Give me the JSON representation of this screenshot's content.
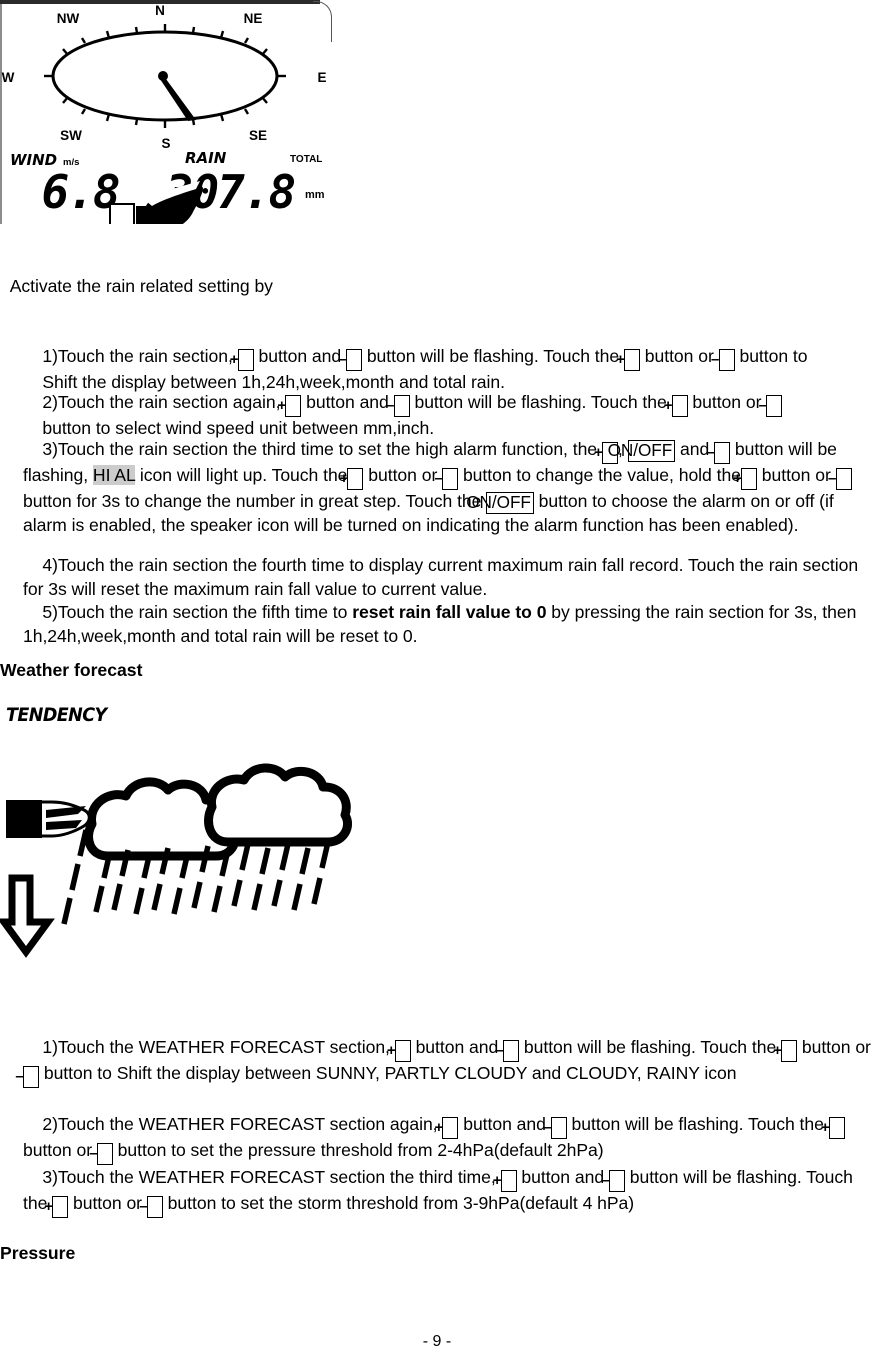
{
  "lcd_display": {
    "title": "wind-rain-lcd-panel",
    "compass": {
      "labels": [
        "N",
        "NE",
        "E",
        "SE",
        "S",
        "SW",
        "W",
        "NW"
      ],
      "needle_direction": "S"
    },
    "wind": {
      "label": "WIND",
      "unit": "m/s",
      "value": "6.8"
    },
    "rain": {
      "label": "RAIN",
      "period_label": "TOTAL",
      "value": "307.8",
      "unit": "mm"
    }
  },
  "rain_section": {
    "intro": "Activate the rain related setting by",
    "items": [
      {
        "number": "1)",
        "line1_a": "Touch the rain section, ",
        "key1": "+",
        "line1_b": " button and ",
        "key2": "–",
        "line1_c": " button will be flashing. Touch the ",
        "key3": "+",
        "line1_d": " button or ",
        "key4": "–",
        "line1_e": " button to",
        "line2": "Shift the display between 1h,24h,week,month and total rain."
      },
      {
        "number": "2)",
        "line1_a": "Touch the rain section again, ",
        "key1": "+",
        "line1_b": " button and ",
        "key2": "–",
        "line1_c": " button will be flashing. Touch the ",
        "key3": "+",
        "line1_d": " button or ",
        "key4": "–",
        "line2": "button to select wind speed unit between mm,inch."
      },
      {
        "number": "3)",
        "a": "Touch the rain section the third time to set the high alarm function, the ",
        "key_plus1": "+",
        "b": ", ",
        "key_onoff1": "ON/OFF",
        "c": " and ",
        "key_minus1": "–",
        "d": " button will be flashing, ",
        "hi_al": "HI AL",
        "e": " icon will light up. Touch the",
        "key_plus2": "+",
        "f": " button or ",
        "key_minus2": "–",
        "g": " button to change the value, hold the",
        "key_plus3": "+",
        "h": " button or ",
        "key_minus3": "–",
        "i": " button for 3s to change the number in great step. Touch the ",
        "key_onoff2": "ON/OFF",
        "j": " button to choose the alarm on or off (if alarm is enabled, the speaker icon will be turned on indicating the alarm function has been enabled)."
      },
      {
        "number": "4)",
        "text": "Touch the rain section the fourth time to display current maximum rain fall record. Touch the rain section for 3s will reset the maximum rain fall value to current value."
      },
      {
        "number": "5)",
        "a": "Touch the rain section the fifth time to ",
        "bold": "reset rain fall value to 0",
        "b": " by pressing the rain section for 3s, then 1h,24h,week,month and total rain will be reset to 0."
      }
    ]
  },
  "weather_forecast": {
    "heading": "Weather forecast",
    "tendency_label": "TENDENCY",
    "icon_name": "rainy-cloud-tendency-falling",
    "items": [
      {
        "number": "1)",
        "a": "Touch the WEATHER FORECAST section, ",
        "key1": "+",
        "b": " button and ",
        "key2": "–",
        "c": " button will be flashing. Touch the ",
        "key3": "+",
        "d": " button or ",
        "key4": "–",
        "e": " button to Shift the display between SUNNY, PARTLY CLOUDY and CLOUDY, RAINY icon"
      },
      {
        "number": "2)",
        "a": "Touch the WEATHER FORECAST section again, ",
        "key1": "+",
        "b": " button and ",
        "key2": "–",
        "c": " button will be flashing. Touch the ",
        "key3": "+",
        "d": " button or ",
        "key4": "–",
        "e": " button to set the pressure threshold from 2-4hPa(default 2hPa)"
      },
      {
        "number": "3)",
        "a": "Touch the WEATHER FORECAST section the third time, ",
        "key1": "+",
        "b": " button and ",
        "key2": "–",
        "c": " button will be flashing. Touch the ",
        "key3": "+",
        "d": " button or ",
        "key4": "–",
        "e": " button to set the storm threshold from 3-9hPa(default 4 hPa)"
      }
    ]
  },
  "pressure_section": {
    "heading": "Pressure"
  },
  "page_footer": "- 9 -"
}
